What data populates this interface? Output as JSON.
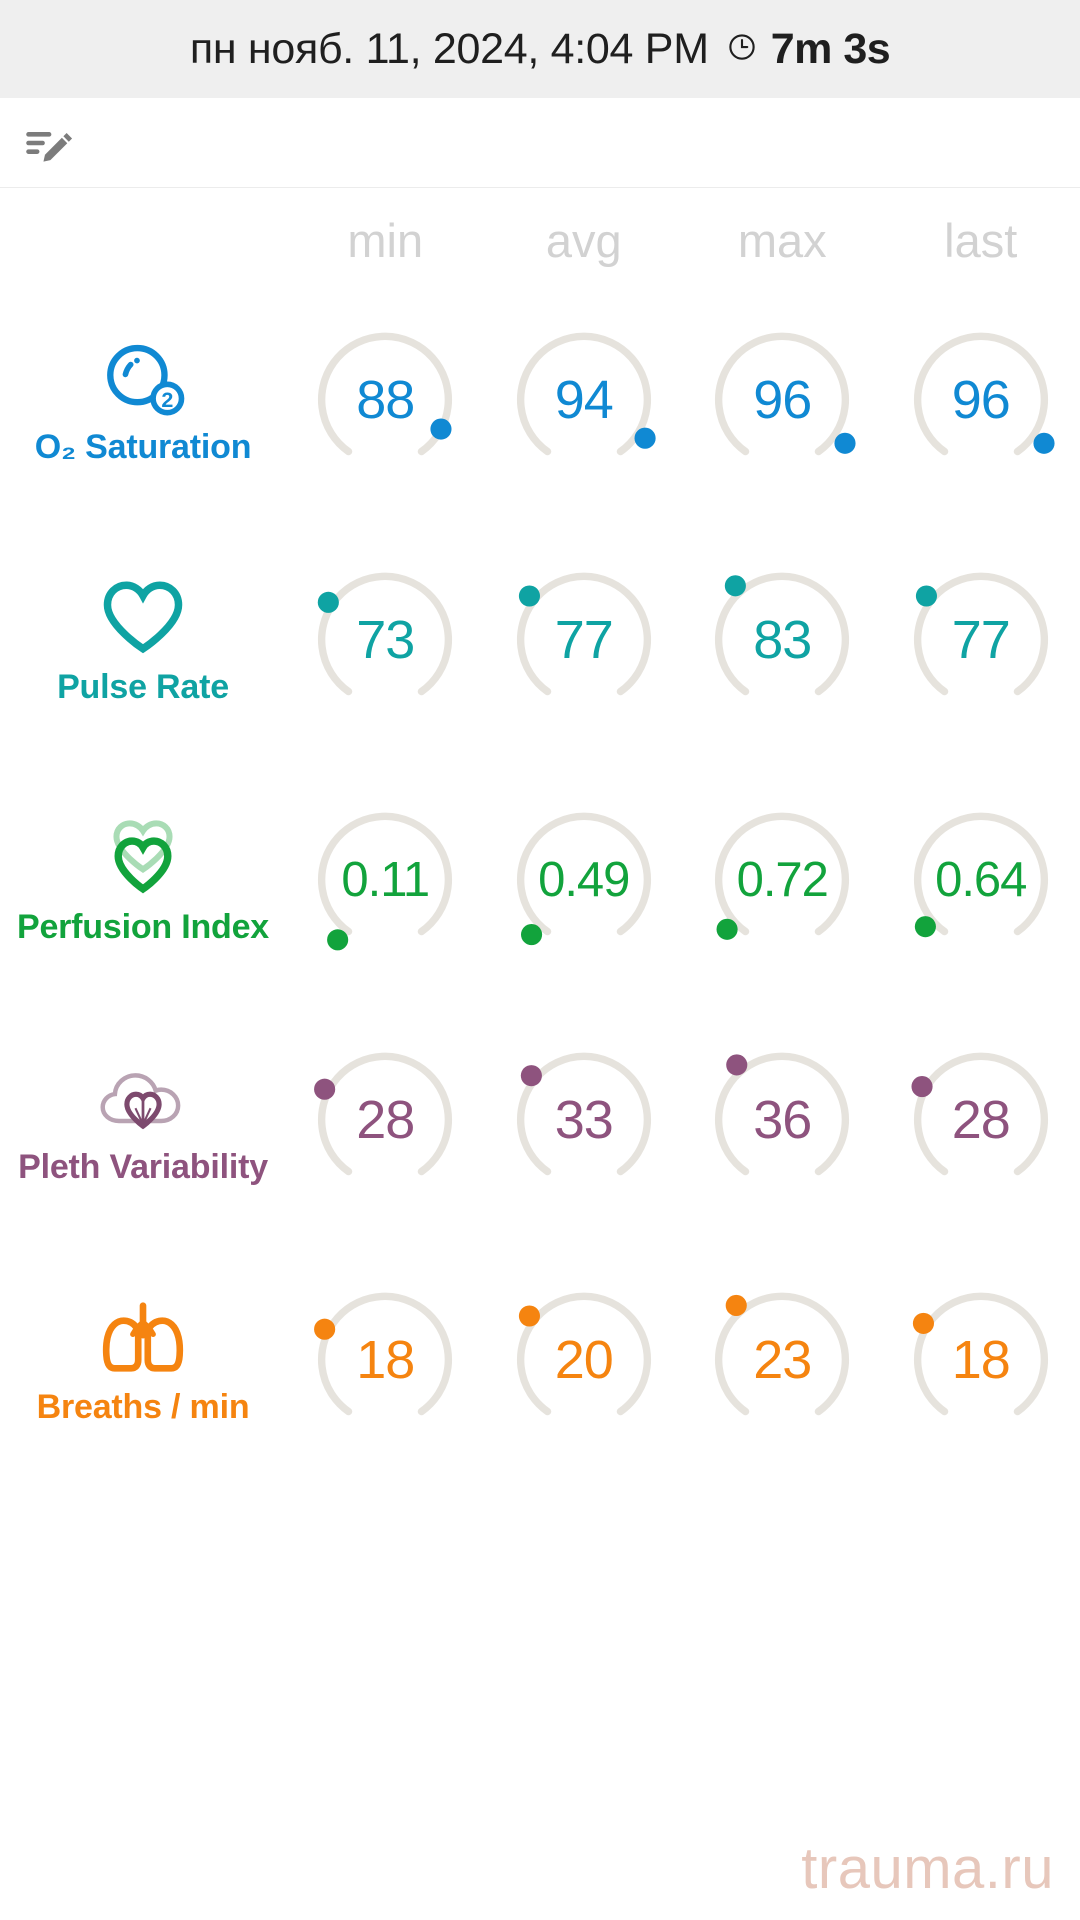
{
  "header": {
    "datetime": "пн нояб. 11, 2024, 4:04 PM",
    "clock_icon": "clock-icon",
    "duration": "7m 3s"
  },
  "toolbar": {
    "edit_note_icon": "edit-note-icon"
  },
  "table": {
    "columns": [
      "min",
      "avg",
      "max",
      "last"
    ],
    "rows": [
      {
        "name": "O₂ Saturation",
        "icon": "oxygen-bubble-icon",
        "color": "#1089d3",
        "values": [
          "88",
          "94",
          "96",
          "96"
        ],
        "dot_angles": [
          62,
          72,
          78,
          86
        ]
      },
      {
        "name": "Pulse Rate",
        "icon": "heart-outline-icon",
        "color": "#0fa3a3",
        "values": [
          "73",
          "77",
          "83",
          "77"
        ],
        "dot_angles": [
          -52,
          -46,
          -34,
          -44
        ]
      },
      {
        "name": "Perfusion Index",
        "icon": "heart-pulse-icon",
        "color": "#12a33c",
        "values": [
          "0.11",
          "0.49",
          "0.72",
          "0.64"
        ],
        "dot_angles": [
          101,
          96,
          90,
          88
        ]
      },
      {
        "name": "Pleth Variability",
        "icon": "cloud-heart-icon",
        "color": "#8e537e",
        "values": [
          "28",
          "33",
          "36",
          "28"
        ],
        "dot_angles": [
          -58,
          -44,
          -34,
          -53
        ]
      },
      {
        "name": "Breaths / min",
        "icon": "lungs-icon",
        "color": "#f58410",
        "values": [
          "18",
          "20",
          "23",
          "18"
        ],
        "dot_angles": [
          -58,
          -46,
          -35,
          -50
        ]
      }
    ]
  },
  "watermark": {
    "text": "trauma.ru",
    "color": "#e7c7bb"
  },
  "colors": {
    "header_background": "#efefef",
    "gauge_track": "#e6e3dd",
    "column_header_text": "#d2d2d2"
  }
}
